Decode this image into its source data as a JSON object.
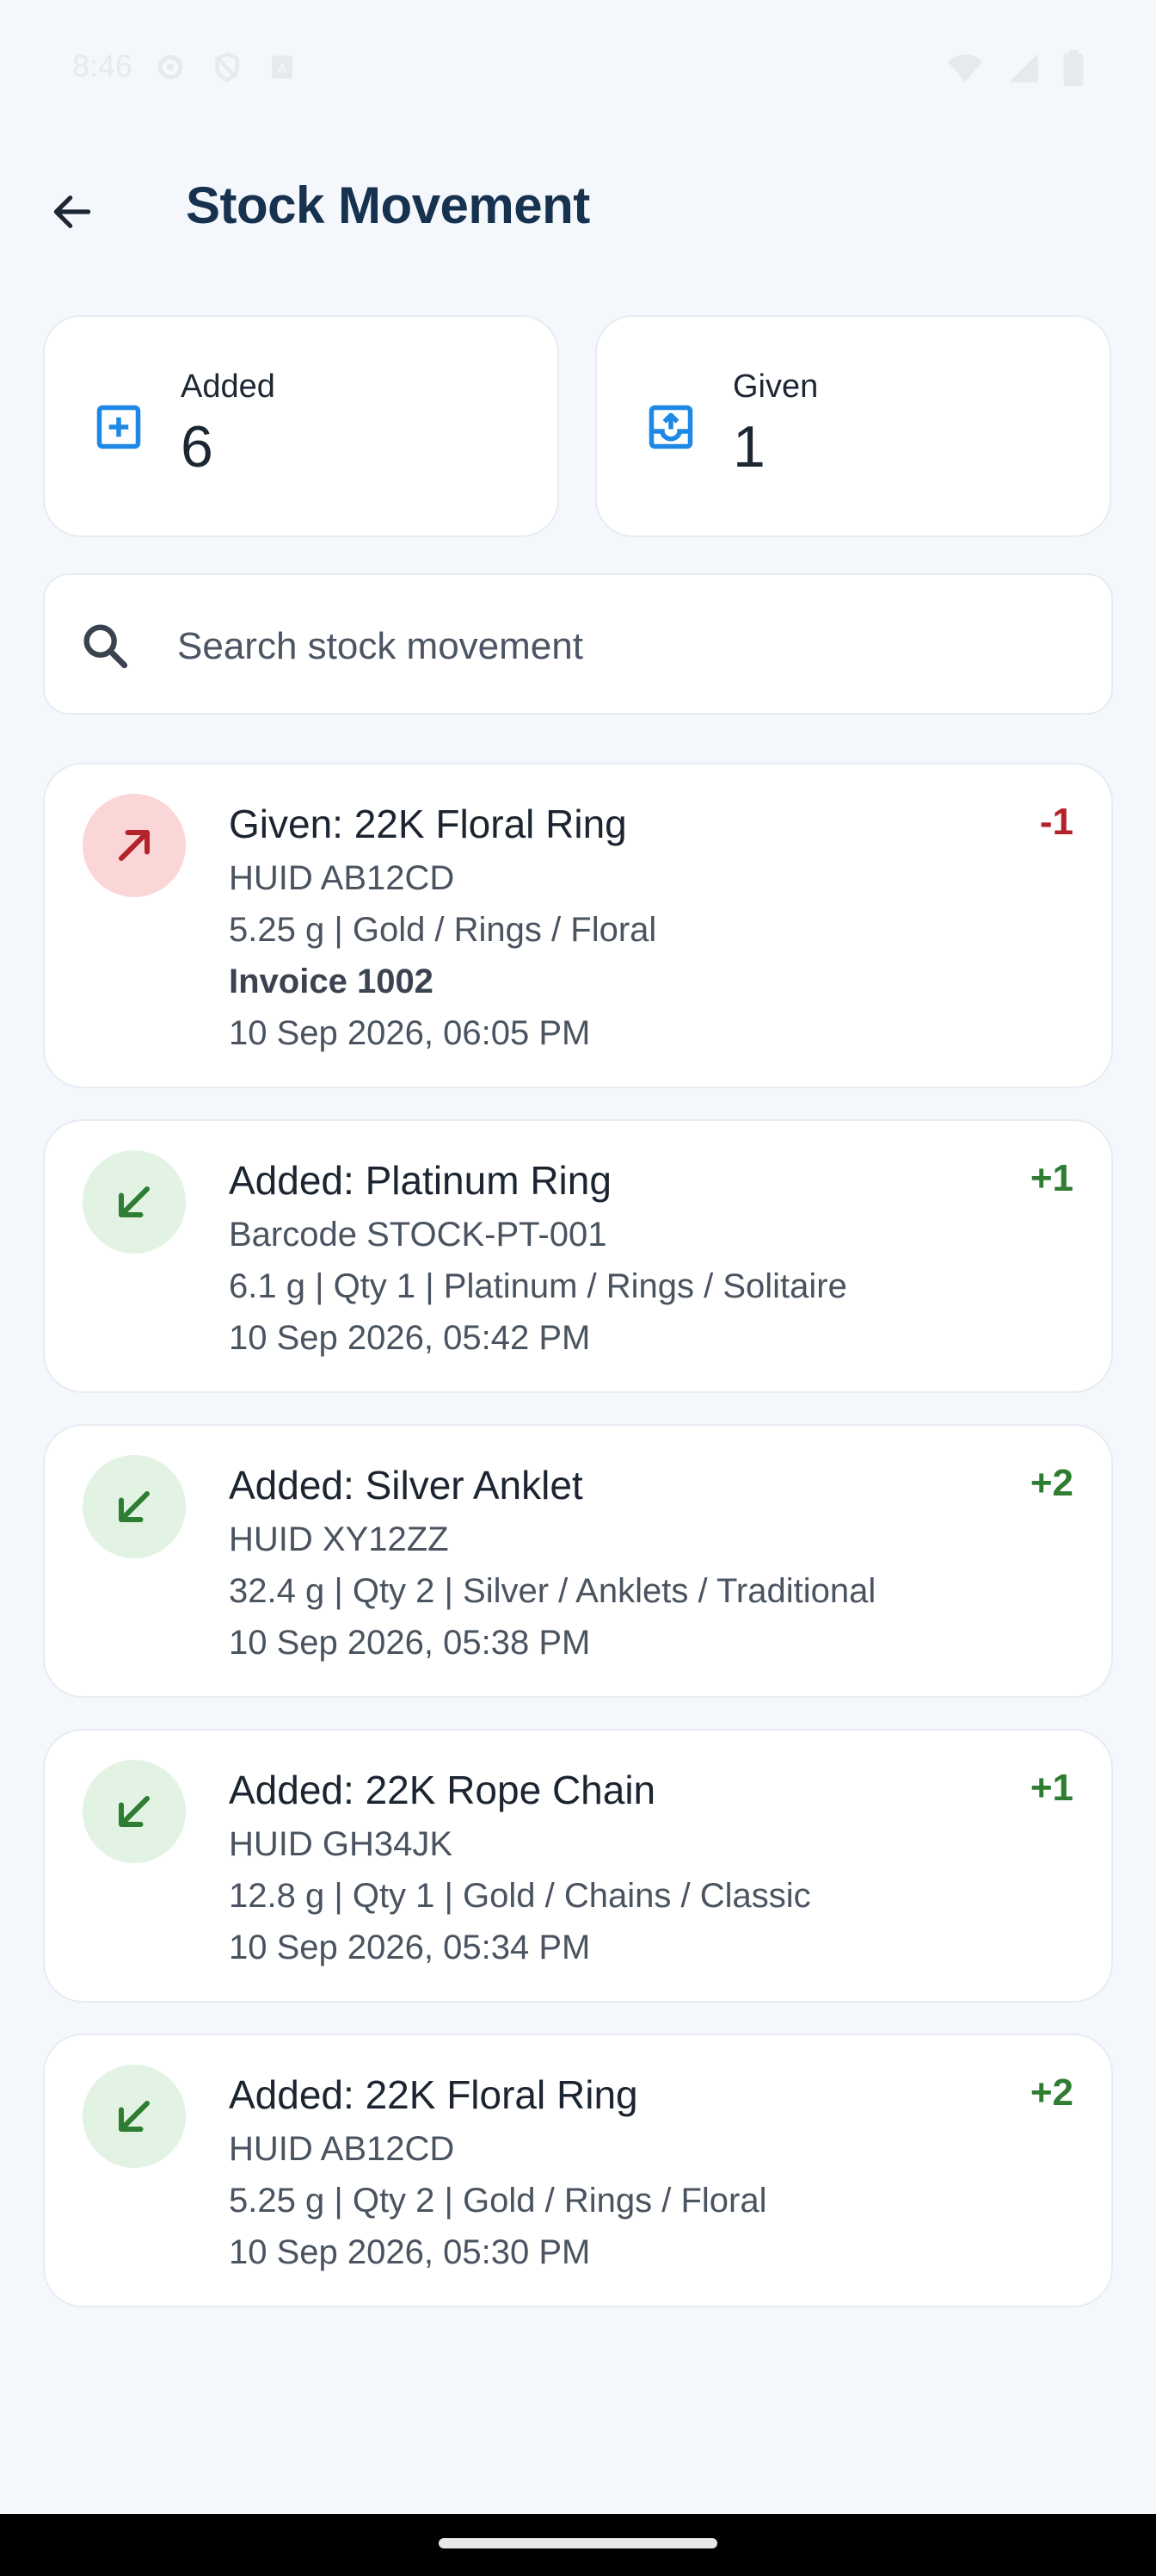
{
  "status_bar": {
    "time": "8:46",
    "left_icons": [
      "settings-icon",
      "shield-icon",
      "sim-icon"
    ],
    "right_icons": [
      "wifi-icon",
      "signal-icon",
      "battery-icon"
    ]
  },
  "header": {
    "title": "Stock Movement",
    "back_icon": "arrow-back-icon"
  },
  "summary": {
    "added": {
      "label": "Added",
      "value": "6",
      "icon": "add-box-icon",
      "color": "#1e88e5"
    },
    "given": {
      "label": "Given",
      "value": "1",
      "icon": "outbox-icon",
      "color": "#1e88e5"
    }
  },
  "search": {
    "placeholder": "Search stock movement",
    "value": "",
    "icon": "search-icon"
  },
  "movements": [
    {
      "type": "given",
      "icon": "arrow-up-right-icon",
      "title": "Given: 22K Floral Ring",
      "delta": "-1",
      "lines": [
        "HUID AB12CD",
        "5.25 g | Gold / Rings / Floral"
      ],
      "invoice": "Invoice 1002",
      "time": "10 Sep 2026, 06:05 PM"
    },
    {
      "type": "added",
      "icon": "arrow-down-left-icon",
      "title": "Added: Platinum Ring",
      "delta": "+1",
      "lines": [
        "Barcode STOCK-PT-001",
        "6.1 g | Qty 1 | Platinum / Rings / Solitaire"
      ],
      "time": "10 Sep 2026, 05:42 PM"
    },
    {
      "type": "added",
      "icon": "arrow-down-left-icon",
      "title": "Added: Silver Anklet",
      "delta": "+2",
      "lines": [
        "HUID XY12ZZ",
        "32.4 g | Qty 2 | Silver / Anklets / Traditional"
      ],
      "time": "10 Sep 2026, 05:38 PM"
    },
    {
      "type": "added",
      "icon": "arrow-down-left-icon",
      "title": "Added: 22K Rope Chain",
      "delta": "+1",
      "lines": [
        "HUID GH34JK",
        "12.8 g | Qty 1 | Gold / Chains / Classic"
      ],
      "time": "10 Sep 2026, 05:34 PM"
    },
    {
      "type": "added",
      "icon": "arrow-down-left-icon",
      "title": "Added: 22K Floral Ring",
      "delta": "+2",
      "lines": [
        "HUID AB12CD",
        "5.25 g | Qty 2 | Gold / Rings / Floral"
      ],
      "time": "10 Sep 2026, 05:30 PM"
    }
  ],
  "colors": {
    "given": "#b4232c",
    "added": "#2e7d32",
    "accent": "#1e88e5",
    "title": "#16324f"
  }
}
